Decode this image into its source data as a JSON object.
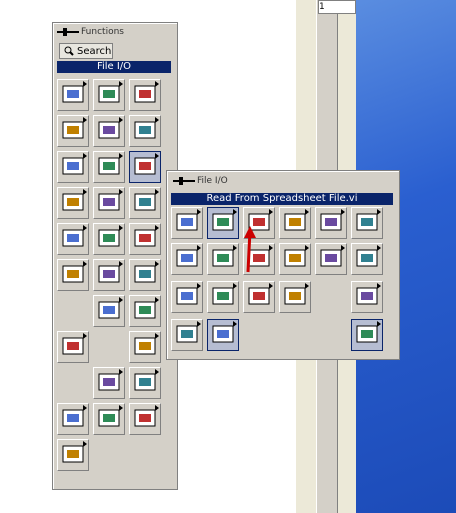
{
  "functions_palette": {
    "title": "Functions",
    "search_label": "Search",
    "category_header": "File I/O"
  },
  "file_io_palette": {
    "title": "File I/O",
    "hovered_item": "Read From Spreadsheet File.vi"
  },
  "background_cell": "1",
  "colors": {
    "header_bg": "#0a246a",
    "palette_bg": "#d4d0c8",
    "desktop": "#2a5fd0",
    "arrow": "#cc0000"
  },
  "icons": {
    "functions": [
      "filter-icon",
      "numeric-icon",
      "boolean-icon",
      "string-icon",
      "array-icon",
      "cluster-icon",
      "comparison-icon",
      "timing-icon",
      "file-io-icon",
      "waveform-icon",
      "analyze-icon",
      "instrument-io-icon",
      "motion-icon",
      "mathematics-icon",
      "signal-icon",
      "data-comm-icon",
      "sync-icon",
      "graphics-icon",
      "report-icon",
      "advanced-icon",
      "select-vi-icon",
      "user-library-icon",
      "express-icon",
      "database-icon",
      "ni-logo-icon",
      "g-icon",
      "shapes-icon",
      "measure-icon"
    ],
    "file_io": [
      "write-spreadsheet-icon",
      "read-spreadsheet-icon",
      "write-characters-icon",
      "read-characters-icon",
      "read-lines-icon",
      "binary-file-icon",
      "open-create-icon",
      "read-file-icon",
      "write-file-icon",
      "format-into-file-icon",
      "scan-from-file-icon",
      "close-file-icon",
      "file-constants-icon",
      "config-file-icon",
      "path-icon",
      "strip-path-icon",
      "build-path-icon",
      "advanced-file-icon",
      "zip-icon",
      "storage-icon",
      "file-dialog-icon",
      "write-measurement-icon"
    ]
  }
}
